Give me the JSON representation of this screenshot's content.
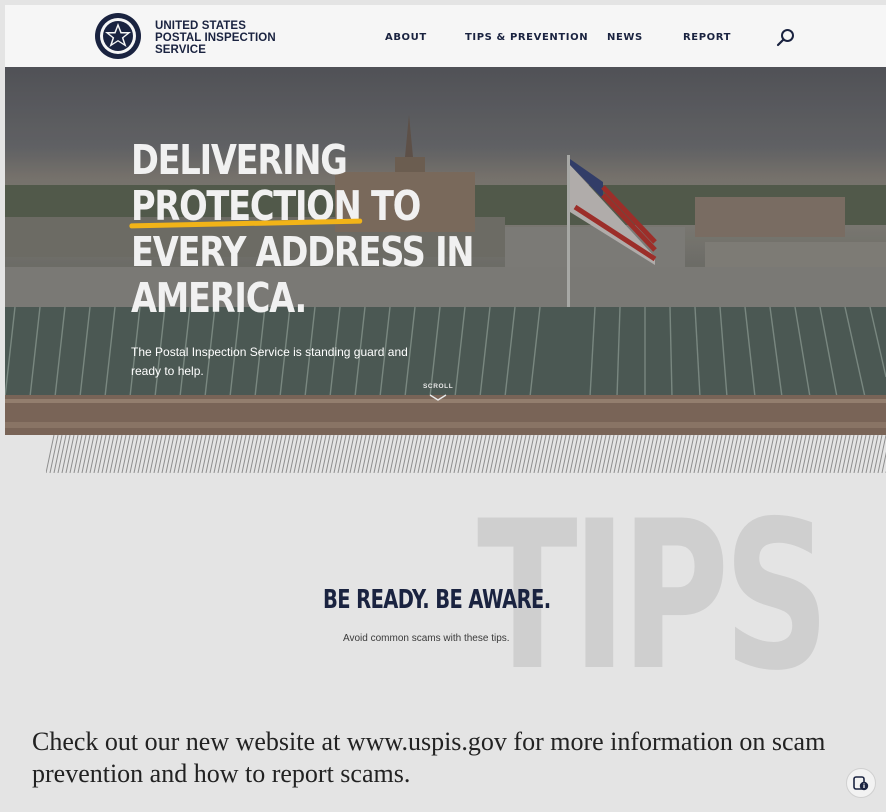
{
  "header": {
    "brand_line1": "UNITED STATES",
    "brand_line2": "POSTAL INSPECTION",
    "brand_line3": "SERVICE",
    "logo_icon": "uspis-seal-icon",
    "nav": [
      {
        "label": "ABOUT"
      },
      {
        "label": "TIPS & PREVENTION"
      },
      {
        "label": "NEWS"
      },
      {
        "label": "REPORT"
      }
    ],
    "search_icon": "search-icon"
  },
  "hero": {
    "headline_line1": "DELIVERING",
    "headline_highlight": "PROTECTION",
    "headline_line2_rest": " TO",
    "headline_line3": "EVERY ADDRESS IN",
    "headline_line4": "AMERICA.",
    "subtitle": "The Postal Inspection Service is standing guard and ready to help.",
    "scroll_label": "SCROLL",
    "accent_color": "#f2b418"
  },
  "tips": {
    "background_word": "TIPS",
    "title": "BE READY. BE AWARE.",
    "subtitle": "Avoid common scams with these tips."
  },
  "notice": {
    "text": "Check out our new website at www.uspis.gov for more information on scam prevention and how to report scams."
  },
  "badge_icon": "accessibility-badge-icon",
  "colors": {
    "navy": "#1a2340",
    "page_bg": "#e4e4e4",
    "header_bg": "#f6f6f6"
  }
}
